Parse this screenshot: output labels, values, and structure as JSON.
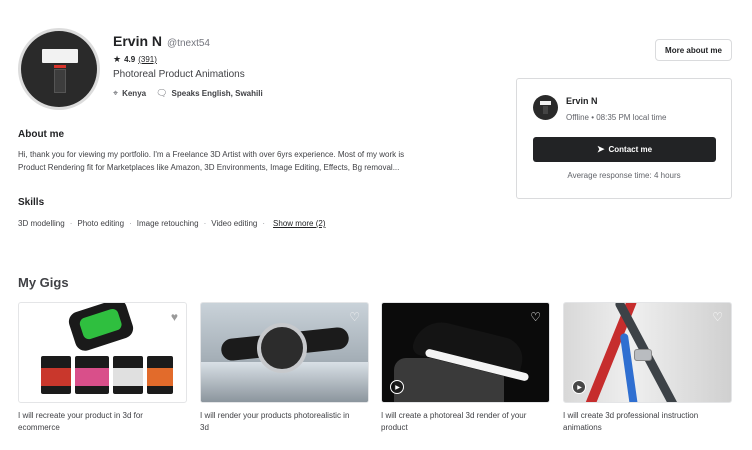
{
  "profile": {
    "name": "Ervin N",
    "handle": "@tnext54",
    "rating": "4.9",
    "reviews": "(391)",
    "tagline": "Photoreal Product Animations",
    "location": "Kenya",
    "languages": "Speaks English, Swahili"
  },
  "about": {
    "title": "About me",
    "text": "Hi, thank you for viewing my portfolio. I'm a Freelance 3D Artist with over 6yrs experience. Most of my work is Product Rendering fit for Marketplaces like Amazon, 3D Environments, Image Editing, Effects, Bg removal..."
  },
  "skills": {
    "title": "Skills",
    "items": [
      "3D modelling",
      "Photo editing",
      "Image retouching",
      "Video editing"
    ],
    "show_more": "Show more (2)"
  },
  "sidebar": {
    "more_button": "More about me",
    "card_name": "Ervin N",
    "status": "Offline • 08:35 PM local time",
    "contact_button": "Contact me",
    "response_time": "Average response time: 4 hours"
  },
  "gigs": {
    "title": "My Gigs",
    "items": [
      {
        "title": "I will recreate your product in 3d for ecommerce",
        "has_video": false
      },
      {
        "title": "I will render your products photorealistic in 3d",
        "has_video": false
      },
      {
        "title": "I will create a photoreal 3d render of your product",
        "has_video": true
      },
      {
        "title": "I will create 3d professional instruction animations",
        "has_video": true
      }
    ]
  },
  "icons": {
    "star": "star-icon",
    "location": "map-pin-icon",
    "speech": "speech-bubble-icon",
    "send": "paper-plane-icon",
    "heart": "heart-icon",
    "play": "play-icon"
  }
}
